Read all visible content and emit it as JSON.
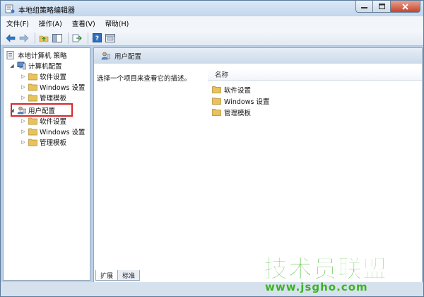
{
  "window": {
    "title": "本地组策略编辑器"
  },
  "menu": [
    "文件(F)",
    "操作(A)",
    "查看(V)",
    "帮助(H)"
  ],
  "toolbar": {
    "icons": [
      "back-arrow-icon",
      "forward-arrow-icon",
      "folder-up-icon",
      "show-hide-tree-icon",
      "export-list-icon",
      "help-icon",
      "properties-icon"
    ]
  },
  "tree": {
    "root": "本地计算机 策略",
    "computer_config": "计算机配置",
    "computer_children": [
      "软件设置",
      "Windows 设置",
      "管理模板"
    ],
    "user_config": "用户配置",
    "user_children": [
      "软件设置",
      "Windows 设置",
      "管理模板"
    ]
  },
  "details": {
    "header_title": "用户配置",
    "description": "选择一个项目来查看它的描述。",
    "column_name": "名称",
    "items": [
      "软件设置",
      "Windows 设置",
      "管理模板"
    ]
  },
  "tabs": [
    "扩展",
    "标准"
  ],
  "watermark": {
    "brand": "技术员联盟",
    "url": "www.jsgho.com"
  },
  "colors": {
    "highlight": "#d9262a",
    "watermark": "#3bb422",
    "folder": "#e8c25a"
  }
}
